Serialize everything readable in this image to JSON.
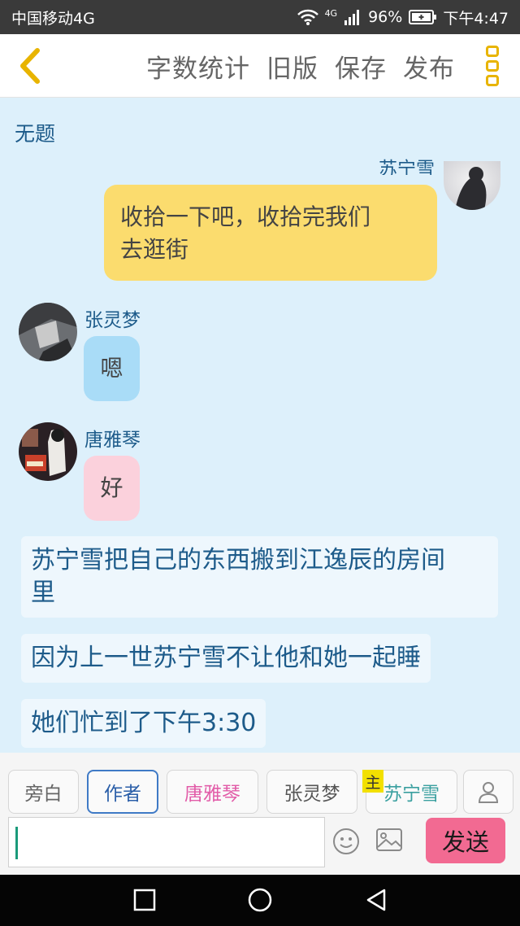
{
  "status_bar": {
    "carrier": "中国移动4G",
    "net": "4G",
    "battery": "96%",
    "time": "下午4:47"
  },
  "header": {
    "actions": [
      "字数统计",
      "旧版",
      "保存",
      "发布"
    ]
  },
  "story": {
    "title": "无题"
  },
  "messages": [
    {
      "speaker": "苏宁雪",
      "text_line1": "收拾一下吧，收拾完我们",
      "text_line2": "去逛街"
    },
    {
      "speaker": "张灵梦",
      "text": "嗯"
    },
    {
      "speaker": "唐雅琴",
      "text": "好"
    }
  ],
  "narrations": [
    {
      "line1": "苏宁雪把自己的东西搬到江逸辰的房间",
      "line2": "里"
    },
    {
      "line1": "因为上一世苏宁雪不让他和她一起睡"
    },
    {
      "line1": "她们忙到了下午3:30"
    }
  ],
  "roles": [
    {
      "label": "旁白",
      "color": "#666666"
    },
    {
      "label": "作者",
      "color": "#2a5ea8"
    },
    {
      "label": "唐雅琴",
      "color": "#e25ca8"
    },
    {
      "label": "张灵梦",
      "color": "#555555"
    },
    {
      "label": "苏宁雪",
      "color": "#3aa0a0"
    }
  ],
  "main_role_badge": "主",
  "input": {
    "value": "",
    "send_label": "发送"
  },
  "colors": {
    "accent": "#e8b400",
    "send": "#f26a92",
    "bubble_yellow": "#fbdc6e",
    "bubble_blue": "#a9dcf7",
    "bubble_pink": "#fbd1dc"
  }
}
